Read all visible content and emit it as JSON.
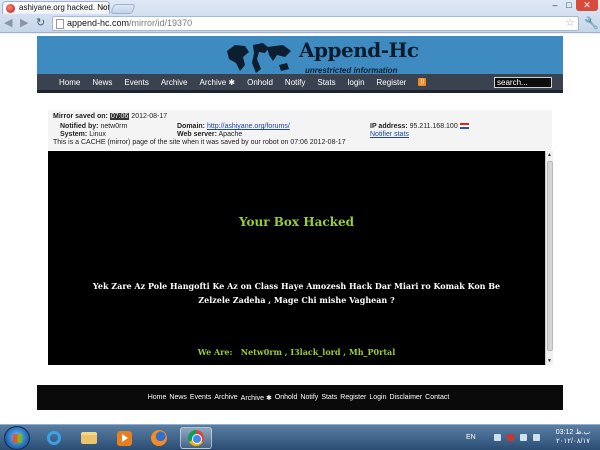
{
  "browser": {
    "tab_title": "ashiyane.org hacked. Notif",
    "tab_close": "×",
    "url_host": "append-hc.com",
    "url_path": "/mirror/id/19370",
    "back": "◀",
    "forward": "▶",
    "reload": "↻",
    "bookmark_star": "☆",
    "wrench": "🔧",
    "minimize": "–",
    "maximize": "□",
    "close": "✕"
  },
  "site": {
    "logo_title": "Append-Hc",
    "logo_subtitle": "unrestricted information",
    "menu": [
      "Home",
      "News",
      "Events",
      "Archive",
      "Archive ✱",
      "Onhold",
      "Notify",
      "Stats",
      "login",
      "Register"
    ],
    "rss_icon": "rss-icon",
    "search_value": "search..."
  },
  "mirror": {
    "saved_label": "Mirror saved on:",
    "saved_time": "07:06",
    "saved_date": "2012-08-17",
    "notified_label": "Notified by:",
    "notified_value": "netw0rm",
    "domain_label": "Domain:",
    "domain_value": "http://ashiyane.org/forums/",
    "ip_label": "IP address:",
    "ip_value": "95.211.168.100",
    "system_label": "System:",
    "system_value": "Linux",
    "webserver_label": "Web server:",
    "webserver_value": "Apache",
    "notifier_stats": "Notifier stats",
    "cache_note": "This is a CACHE (mirror) page of the site when it was saved by our robot on 07:06 2012-08-17"
  },
  "defacement": {
    "title": "Your Box Hacked",
    "message": "Yek Zare Az Pole Hangofti Ke Az on Class Haye Amozesh Hack Dar Miari ro Komak Kon Be Zelzele Zadeha , Mage Chi mishe Vaghean ?",
    "signature": "We Are:   Netw0rm , I3lack_lord , Mh_P0rtal"
  },
  "footer": {
    "links": [
      "Home",
      "News",
      "Events",
      "Archive",
      "Archive ✱",
      "Onhold",
      "Notify",
      "Stats",
      "Register",
      "Login",
      "Disclaimer",
      "Contact"
    ]
  },
  "taskbar": {
    "language": "EN",
    "clock_time": "03:12 ب.ظ",
    "clock_date": "۲۰۱۲/۰۸/۱۷"
  },
  "colors": {
    "header_blue": "#3d8bc0",
    "hacked_green": "#9acd32",
    "menu_bg": "#3a4250"
  }
}
